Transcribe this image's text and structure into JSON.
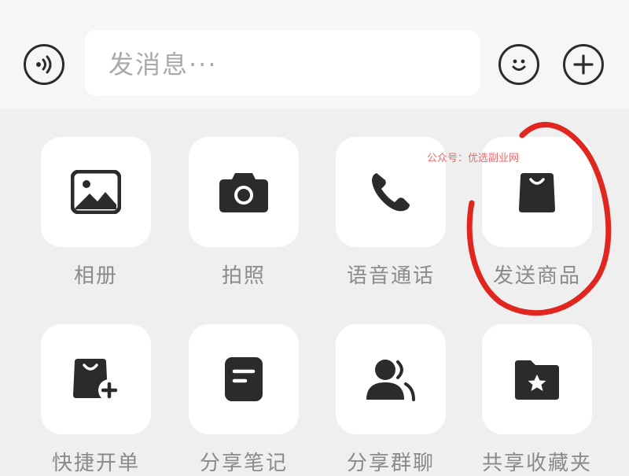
{
  "input_bar": {
    "placeholder": "发消息···",
    "voice_icon": "voice-icon",
    "emoji_icon": "emoji-icon",
    "plus_icon": "plus-icon"
  },
  "actions": [
    {
      "label": "相册",
      "icon": "photo-album-icon"
    },
    {
      "label": "拍照",
      "icon": "camera-icon"
    },
    {
      "label": "语音通话",
      "icon": "phone-icon"
    },
    {
      "label": "发送商品",
      "icon": "shopping-bag-icon"
    },
    {
      "label": "快捷开单",
      "icon": "quick-order-icon"
    },
    {
      "label": "分享笔记",
      "icon": "note-icon"
    },
    {
      "label": "分享群聊",
      "icon": "group-chat-icon"
    },
    {
      "label": "共享收藏夹",
      "icon": "shared-folder-icon"
    }
  ],
  "watermark": "公众号：优选副业网",
  "colors": {
    "icon": "#2b2b2b",
    "annotation": "#e0261e",
    "label": "#8a8a8a"
  }
}
